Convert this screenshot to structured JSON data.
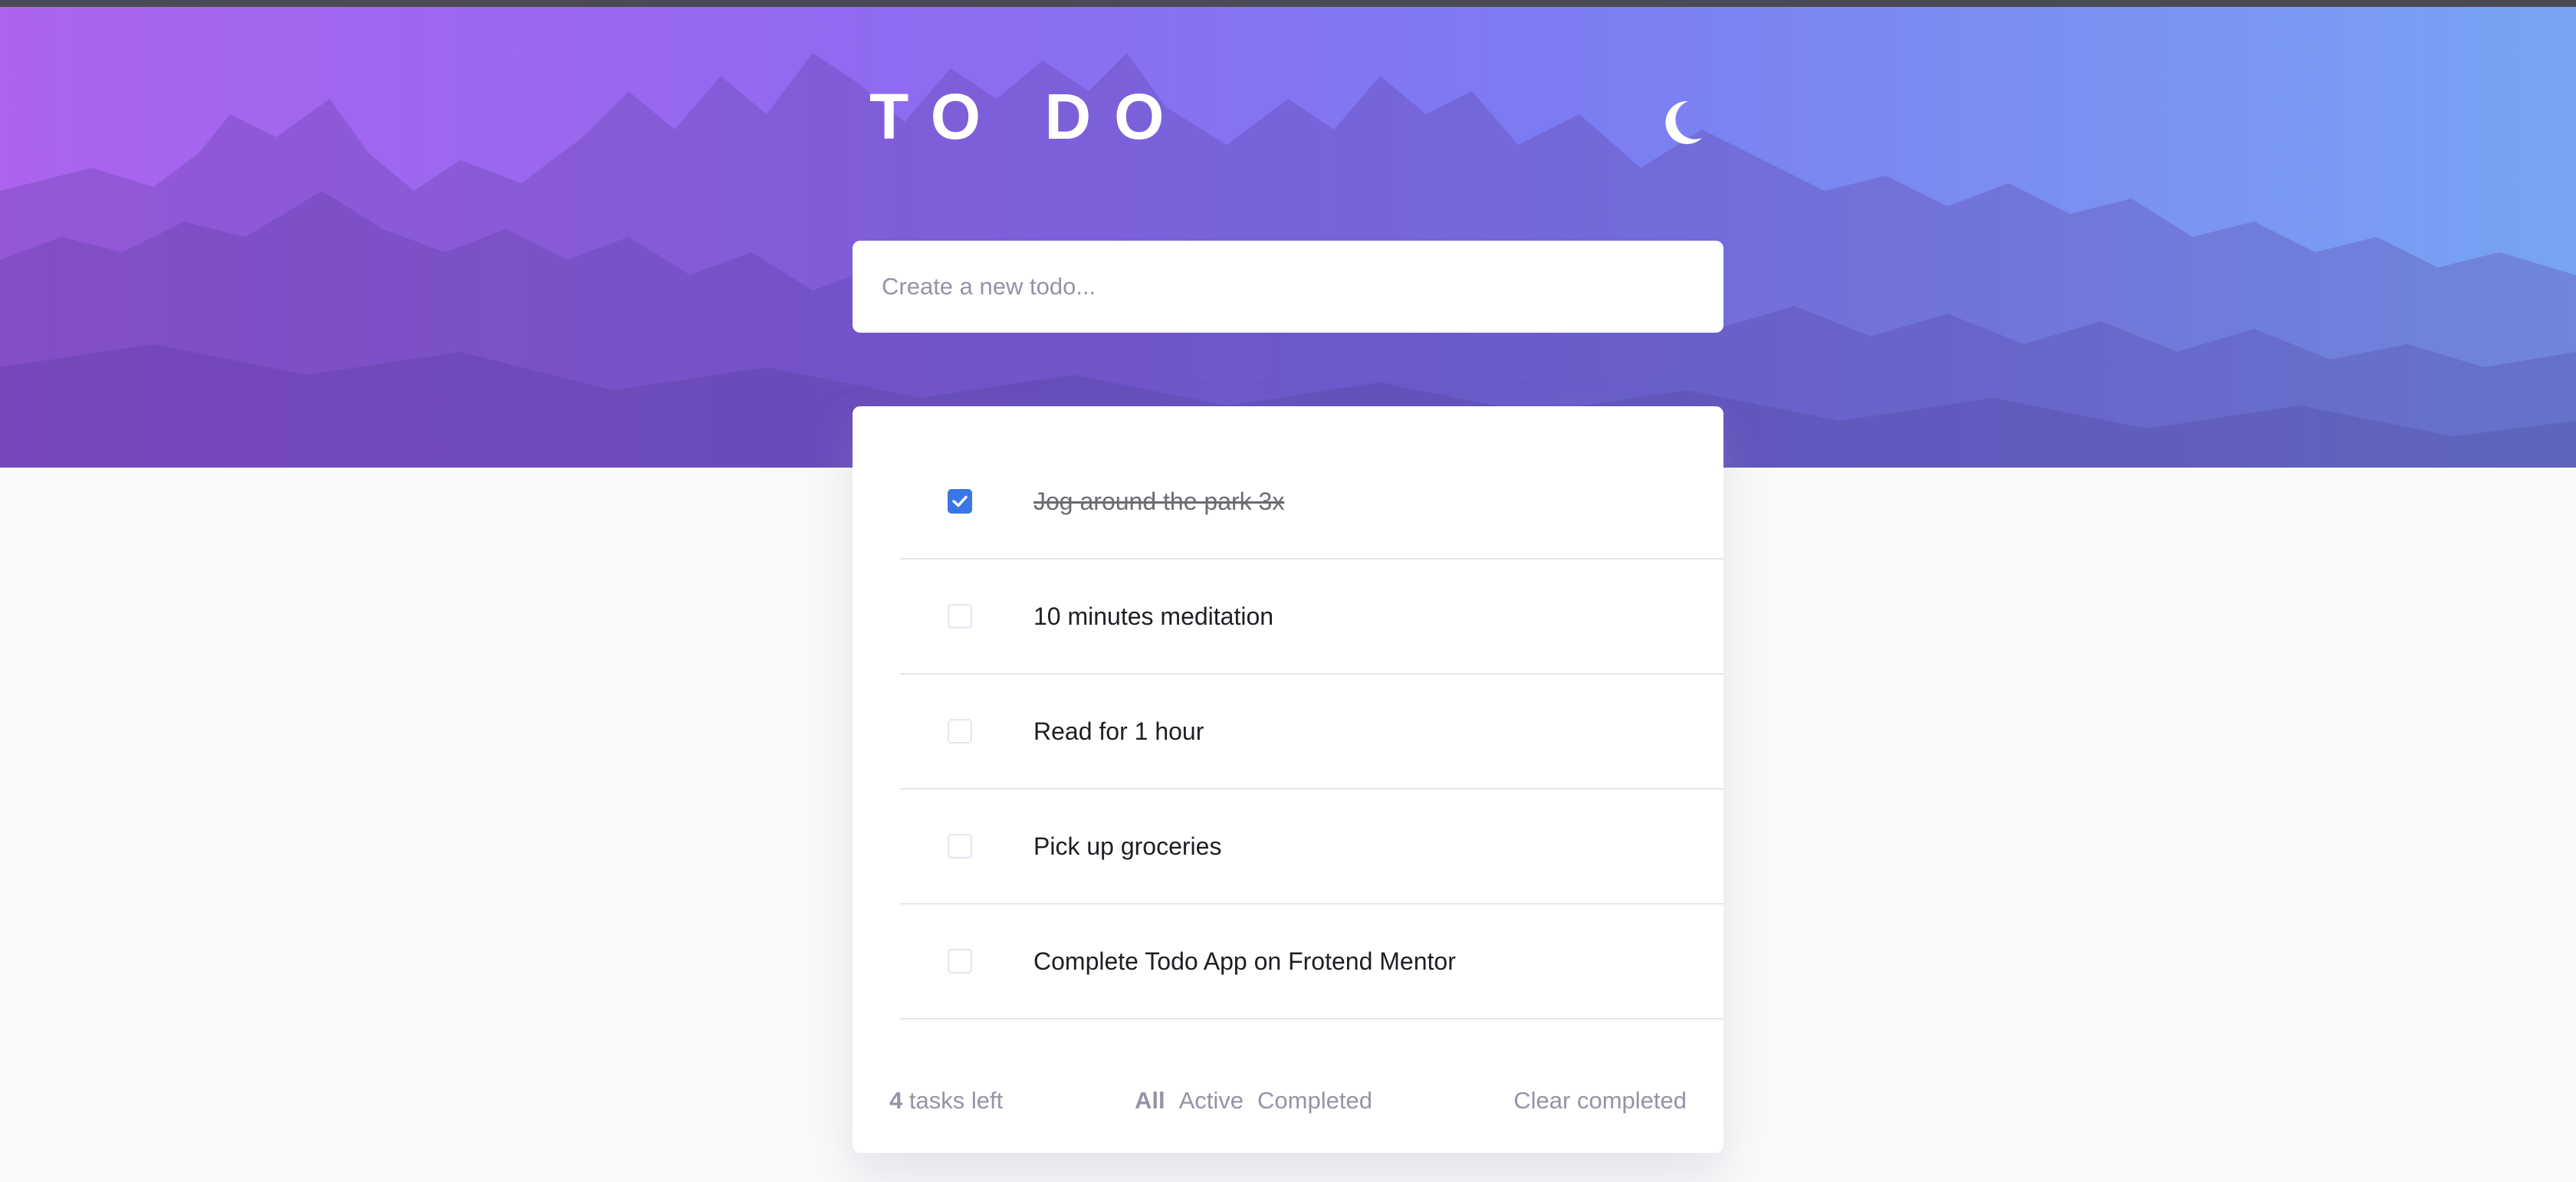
{
  "header": {
    "title": "TO DO",
    "theme_toggle_icon": "moon-icon"
  },
  "new_todo": {
    "placeholder": "Create a new todo...",
    "value": ""
  },
  "todos": [
    {
      "text": "Jog around the park 3x",
      "completed": true
    },
    {
      "text": "10 minutes meditation",
      "completed": false
    },
    {
      "text": "Read for 1 hour",
      "completed": false
    },
    {
      "text": "Pick up groceries",
      "completed": false
    },
    {
      "text": "Complete Todo App on Frotend Mentor",
      "completed": false
    }
  ],
  "footer": {
    "items_left_count": "4",
    "items_left_suffix": " tasks left",
    "filters": [
      {
        "label": "All",
        "active": true
      },
      {
        "label": "Active",
        "active": false
      },
      {
        "label": "Completed",
        "active": false
      }
    ],
    "clear_label": "Clear completed"
  },
  "colors": {
    "gradient_start": "#ac63ee",
    "gradient_end": "#78a4f2",
    "check_blue": "#3b76e8",
    "muted_text": "#9394a5",
    "page_bg": "#fafafa"
  }
}
